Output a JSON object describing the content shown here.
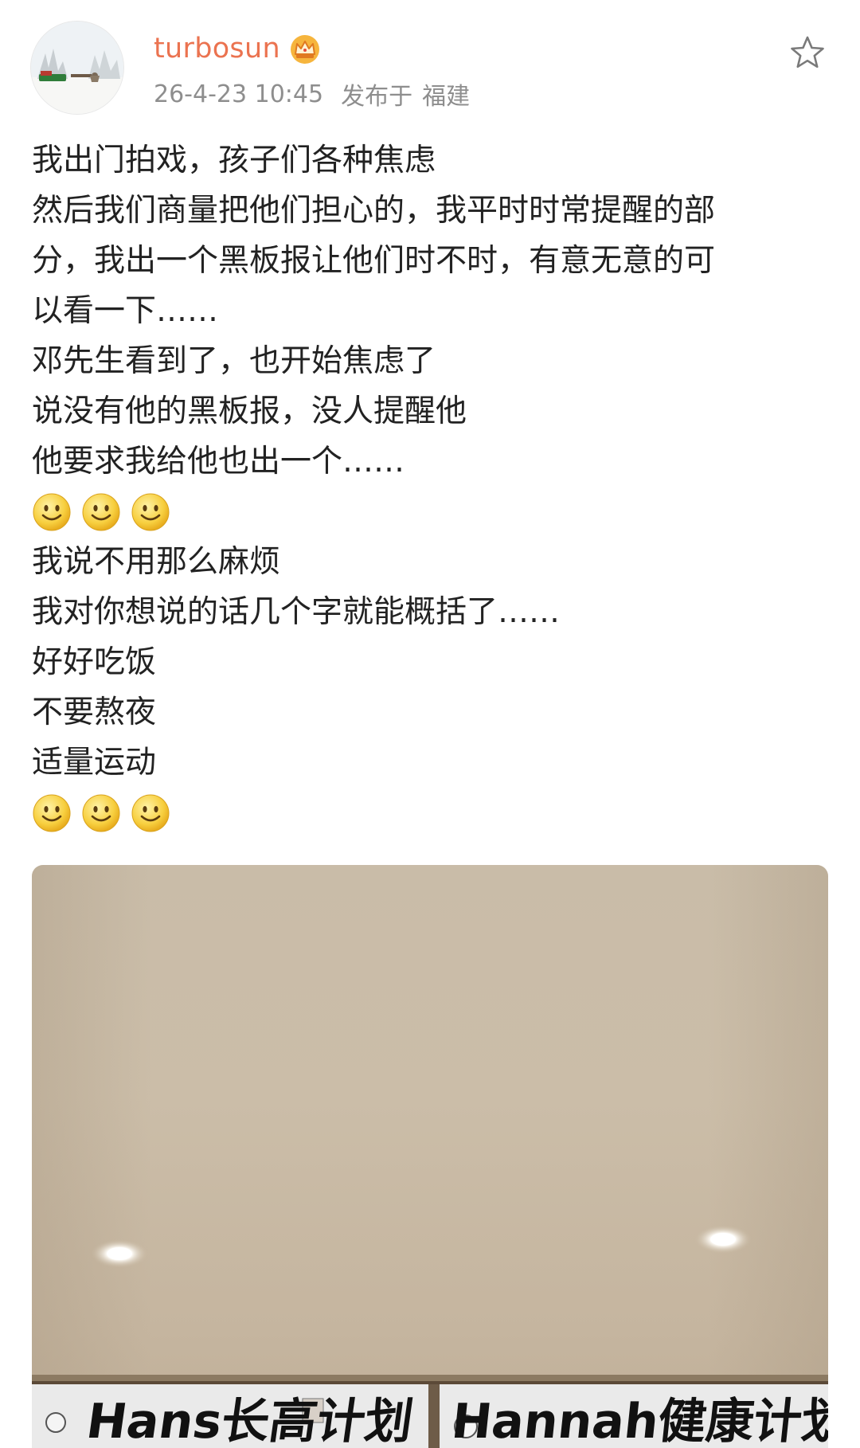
{
  "header": {
    "username": "turbosun",
    "date": "26-4-23 10:45",
    "posted_label": "发布于",
    "location": "福建",
    "icons": {
      "badge": "crown-icon",
      "favorite": "star-icon"
    }
  },
  "post": {
    "lines": [
      "我出门拍戏，孩子们各种焦虑",
      "然后我们商量把他们担心的，我平时时常提醒的部",
      "分，我出一个黑板报让他们时不时，有意无意的可",
      "以看一下……",
      "邓先生看到了，也开始焦虑了",
      "说没有他的黑板报，没人提醒他",
      "他要求我给他也出一个……",
      "我说不用那么麻烦",
      "我对你想说的话几个字就能概括了……",
      "好好吃饭",
      "不要熬夜",
      "适量运动"
    ],
    "emoji_icon": "smile-icon"
  },
  "photo": {
    "board_left_text": "Hans长高计划",
    "board_right_text": "Hannah健康计划"
  },
  "colors": {
    "username": "#eb7350",
    "meta": "#8e8e8e",
    "text": "#222222"
  }
}
